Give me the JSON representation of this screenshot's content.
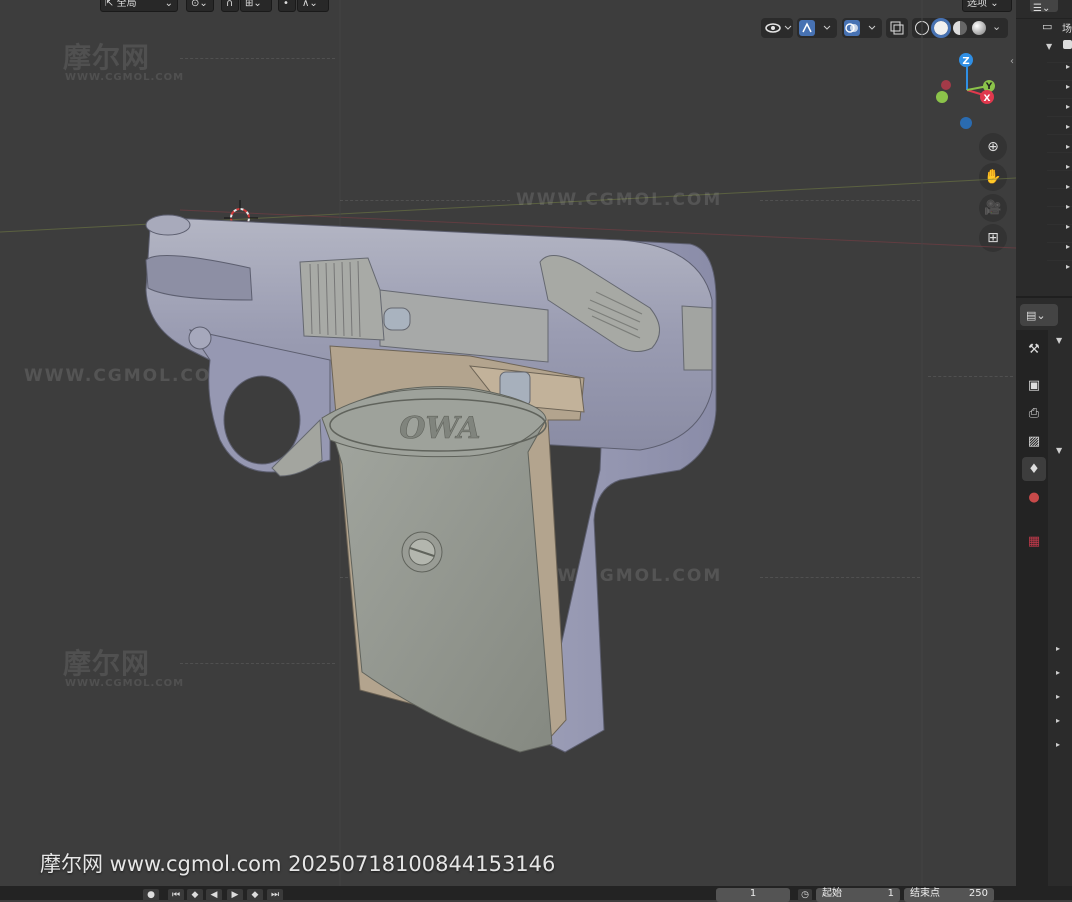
{
  "header": {
    "transform_orientation": "全局",
    "options_label": "选项"
  },
  "gizmo": {
    "z": "Z",
    "y": "Y",
    "x": "X"
  },
  "watermarks": {
    "brand_cn": "摩尔网",
    "brand_en": "WWW.CGMOL.COM",
    "url": "WWW.CGMOL.COM"
  },
  "model": {
    "grip_logo": "OWA"
  },
  "credit": "摩尔网 www.cgmol.com 20250718100844153146",
  "outliner": {
    "scene_label": "场"
  },
  "timeline": {
    "current_frame": "1",
    "start_label": "起始",
    "start_value": "1",
    "end_label": "结束点",
    "end_value": "250"
  },
  "colors": {
    "viewport_bg": "#3d3d3d",
    "slide": "#8f8fa8",
    "grip": "#8f938c",
    "tan": "#b3a48e",
    "axis_x": "#e0384d",
    "axis_y": "#8bc34a",
    "axis_z": "#2f8fe5"
  }
}
